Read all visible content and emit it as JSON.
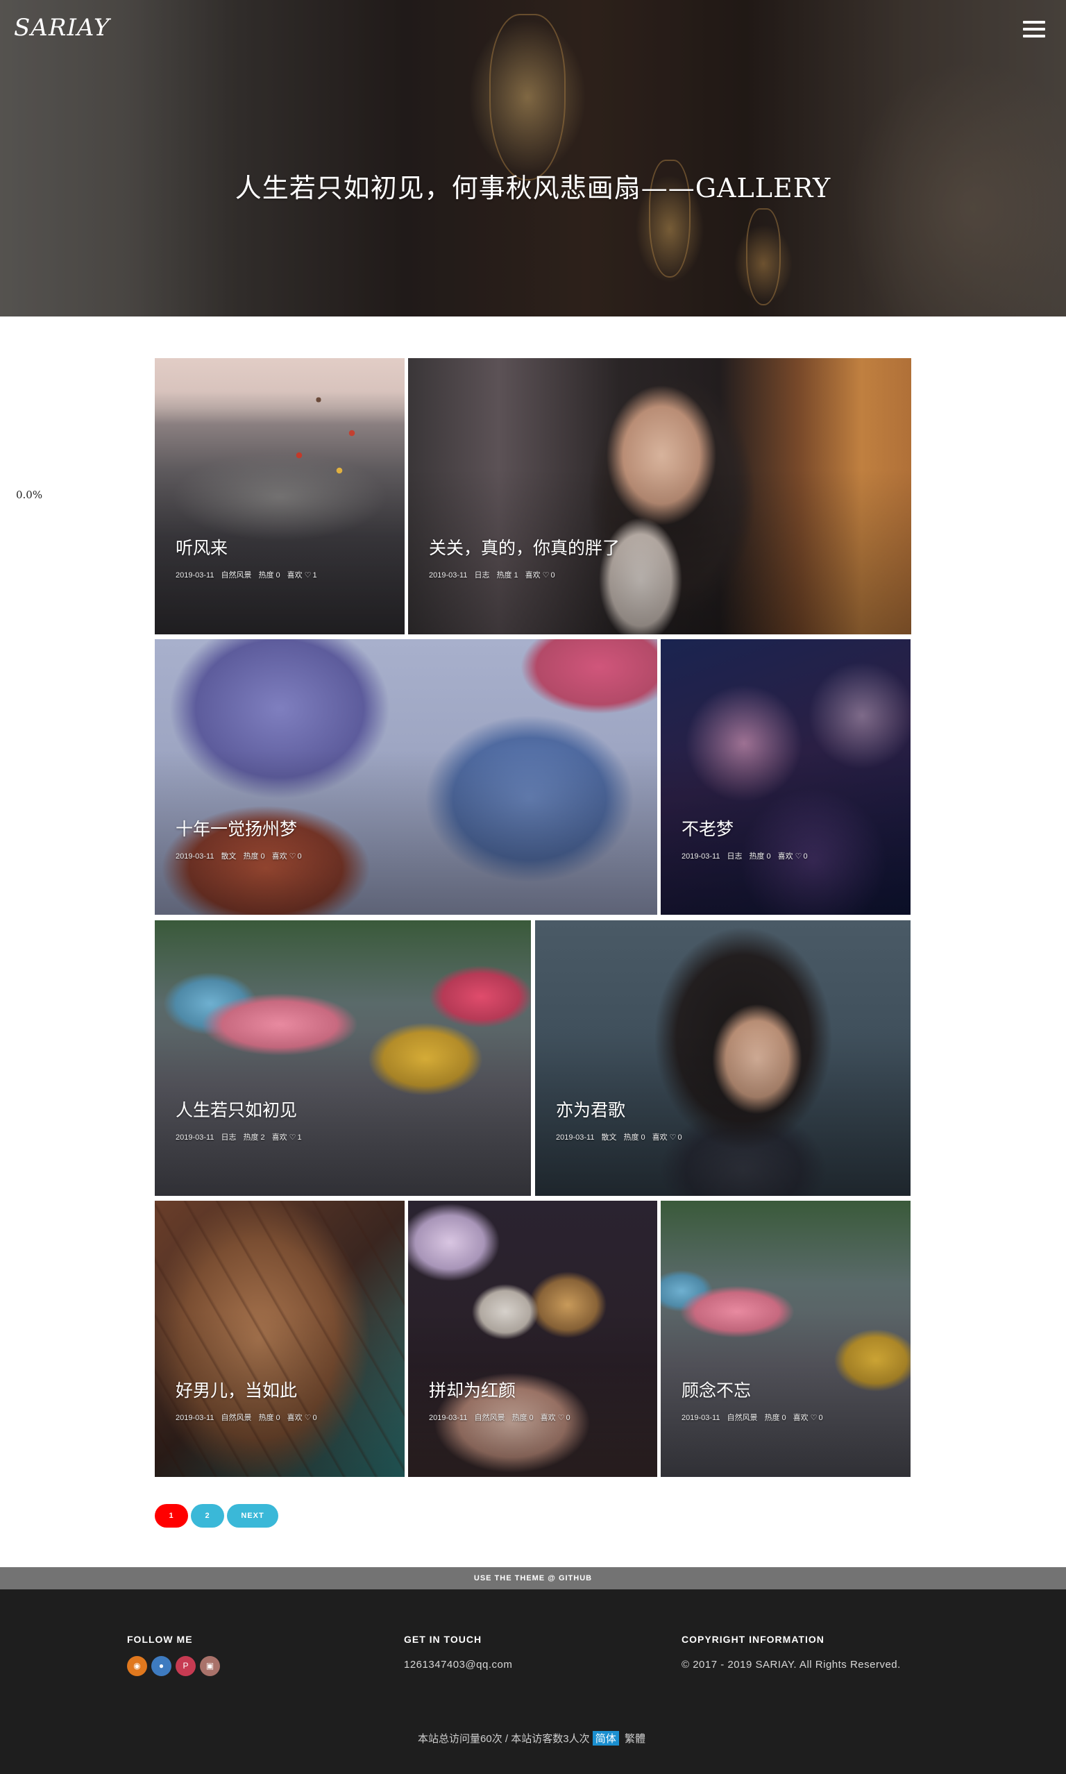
{
  "header": {
    "logo": "SARIAY",
    "title": "人生若只如初见，何事秋风悲画扇——GALLERY"
  },
  "progress": "0.0%",
  "posts": [
    {
      "title": "听风来",
      "date": "2019-03-11",
      "category": "自然风景",
      "hot_label": "热度",
      "hot": "0",
      "like_label": "喜欢",
      "likes": "1"
    },
    {
      "title": "关关，真的，你真的胖了",
      "date": "2019-03-11",
      "category": "日志",
      "hot_label": "热度",
      "hot": "1",
      "like_label": "喜欢",
      "likes": "0"
    },
    {
      "title": "十年一觉扬州梦",
      "date": "2019-03-11",
      "category": "散文",
      "hot_label": "热度",
      "hot": "0",
      "like_label": "喜欢",
      "likes": "0"
    },
    {
      "title": "不老梦",
      "date": "2019-03-11",
      "category": "日志",
      "hot_label": "热度",
      "hot": "0",
      "like_label": "喜欢",
      "likes": "0"
    },
    {
      "title": "人生若只如初见",
      "date": "2019-03-11",
      "category": "日志",
      "hot_label": "热度",
      "hot": "2",
      "like_label": "喜欢",
      "likes": "1"
    },
    {
      "title": "亦为君歌",
      "date": "2019-03-11",
      "category": "散文",
      "hot_label": "热度",
      "hot": "0",
      "like_label": "喜欢",
      "likes": "0"
    },
    {
      "title": "好男儿，当如此",
      "date": "2019-03-11",
      "category": "自然风景",
      "hot_label": "热度",
      "hot": "0",
      "like_label": "喜欢",
      "likes": "0"
    },
    {
      "title": "拼却为红颜",
      "date": "2019-03-11",
      "category": "自然风景",
      "hot_label": "热度",
      "hot": "0",
      "like_label": "喜欢",
      "likes": "0"
    },
    {
      "title": "顾念不忘",
      "date": "2019-03-11",
      "category": "自然风景",
      "hot_label": "热度",
      "hot": "0",
      "like_label": "喜欢",
      "likes": "0"
    }
  ],
  "pagination": {
    "page1": "1",
    "page2": "2",
    "next": "NEXT",
    "active_color": "#ff0000",
    "color": "#3ab8d8"
  },
  "footer": {
    "github": "USE THE THEME @ GITHUB",
    "follow_heading": "FOLLOW ME",
    "social_icons": [
      {
        "name": "rss-icon",
        "color": "#e0781e"
      },
      {
        "name": "github-icon",
        "color": "#3e7bc0"
      },
      {
        "name": "pinterest-icon",
        "color": "#c73b52"
      },
      {
        "name": "instagram-icon",
        "color": "#a9726a"
      }
    ],
    "touch_heading": "GET IN TOUCH",
    "email": "1261347403@qq.com",
    "copyright_heading": "COPYRIGHT INFORMATION",
    "copyright": "© 2017 - 2019 SARIAY. All Rights Reserved.",
    "stats": "本站总访问量60次 / 本站访客数3人次",
    "lang_simplified": "简体",
    "lang_traditional": "繁體"
  }
}
